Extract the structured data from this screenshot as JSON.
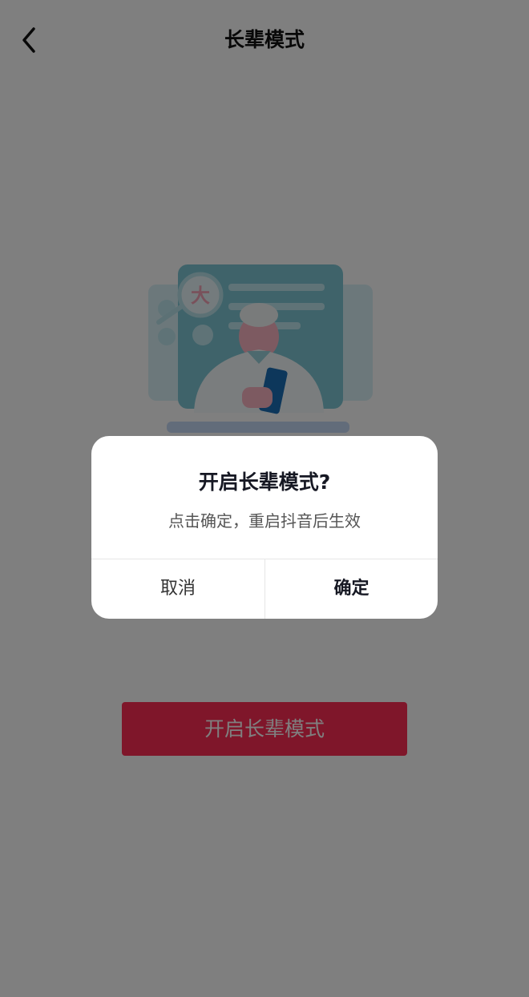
{
  "header": {
    "title": "长辈模式",
    "back_icon": "chevron-left-icon"
  },
  "illustration": {
    "magnifier_text": "大"
  },
  "main": {
    "enable_label": "开启长辈模式"
  },
  "dialog": {
    "title": "开启长辈模式?",
    "message": "点击确定，重启抖音后生效",
    "cancel_label": "取消",
    "confirm_label": "确定"
  },
  "colors": {
    "accent": "#fe2c55",
    "overlay": "rgba(0,0,0,0.5)"
  }
}
